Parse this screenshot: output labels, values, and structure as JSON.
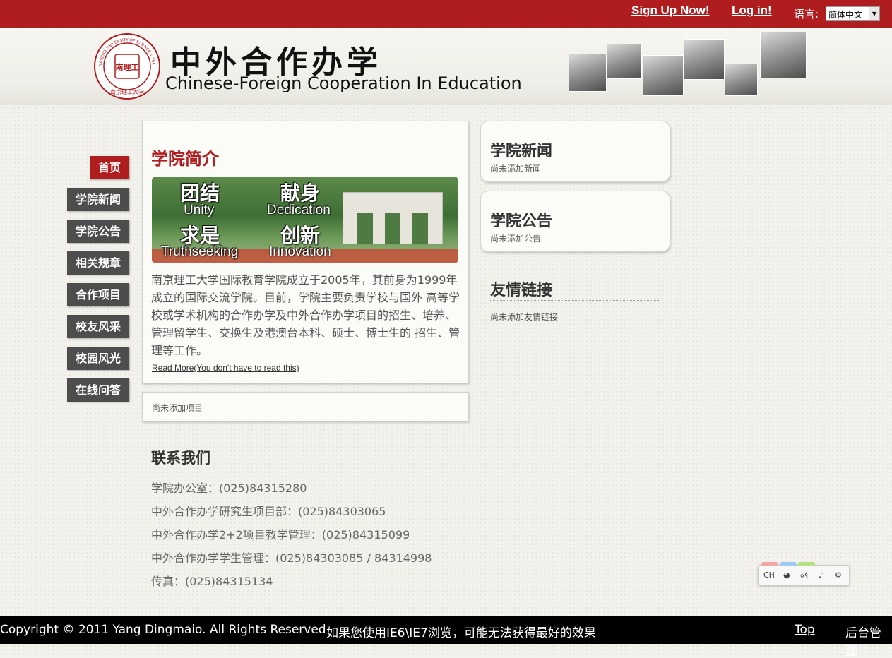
{
  "topbar": {
    "signup": "Sign Up Now!",
    "login": "Log in!",
    "lang_label": "语言:",
    "lang_value": "简体中文"
  },
  "header": {
    "title_cn": "中外合作办学",
    "title_en": "Chinese-Foreign Cooperation In Education",
    "logo_center": "南理工",
    "logo_ring_text": "NANJING UNIVERSITY OF SCIENCE & TECHNOLOGY",
    "logo_bottom_text": "南京理工大学"
  },
  "nav": {
    "items": [
      "首页",
      "学院新闻",
      "学院公告",
      "相关规章",
      "合作项目",
      "校友风采",
      "校园风光",
      "在线问答"
    ]
  },
  "intro": {
    "title": "学院简介",
    "banner": {
      "unity_cn": "团结",
      "unity_en": "Unity",
      "dedication_cn": "献身",
      "dedication_en": "Dedication",
      "truth_cn": "求是",
      "truth_en": "Truthseeking",
      "innovation_cn": "创新",
      "innovation_en": "Innovation"
    },
    "text": "南京理工大学国际教育学院成立于2005年，其前身为1999年成立的国际交流学院。目前，学院主要负责学校与国外 高等学校或学术机构的合作办学及中外合作办学项目的招生、培养、管理留学生、交换生及港澳台本科、硕士、博士生的 招生、管理等工作。",
    "read_more": "Read More(You don't have to read this)"
  },
  "projects": {
    "empty": "尚未添加项目"
  },
  "contact": {
    "title": "联系我们",
    "lines": [
      "学院办公室：(025)84315280",
      "中外合作办学研究生项目部：(025)84303065",
      "中外合作办学2+2项目教学管理：(025)84315099",
      "中外合作办学学生管理：(025)84303085 / 84314998",
      "传真：(025)84315134"
    ]
  },
  "news": {
    "title": "学院新闻",
    "empty": "尚未添加新闻"
  },
  "notices": {
    "title": "学院公告",
    "empty": "尚未添加公告"
  },
  "links": {
    "title": "友情链接",
    "empty": "尚未添加友情链接"
  },
  "toolbar": {
    "ch": "CH",
    "item2": "◕",
    "item3": "०९",
    "item4": "♪",
    "item5": "⚙"
  },
  "footer": {
    "copyright": "Copyright © 2011 Yang Dingmaio. All Rights Reserved",
    "notice": "如果您使用IE6\\IE7浏览，可能无法获得最好的效果",
    "top": "Top",
    "admin": "后台管理"
  },
  "colors": {
    "brand_red": "#b01d1f",
    "nav_dark": "#4d4d4d"
  }
}
